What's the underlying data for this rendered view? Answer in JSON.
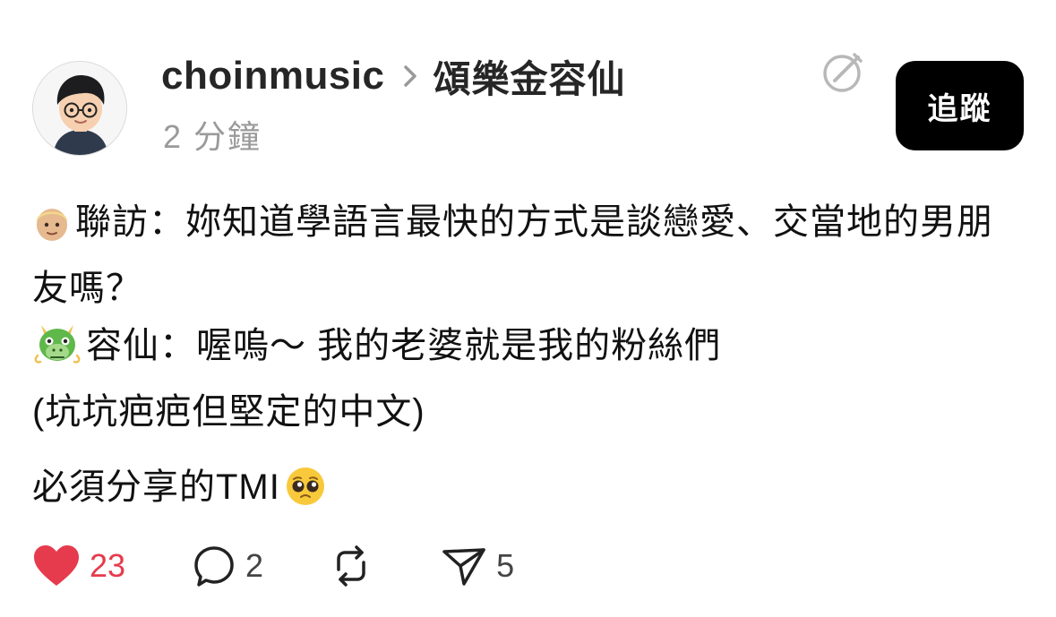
{
  "post": {
    "username": "choinmusic",
    "community": "頌樂金容仙",
    "timestamp": "2 分鐘",
    "follow_label": "追蹤",
    "lines": [
      "聯訪：妳知道學語言最快的方式是談戀愛、交當地的男朋友嗎？",
      "容仙：喔嗚～ 我的老婆就是我的粉絲們",
      "(坑坑疤疤但堅定的中文)",
      "必須分享的TMI"
    ],
    "emojis": [
      "person-face-emoji",
      "dragon-face-emoji",
      "pleading-face-emoji"
    ]
  },
  "actions": {
    "likes": "23",
    "comments": "2",
    "shares": "5"
  },
  "colors": {
    "like_red": "#e63b4d",
    "follow_bg": "#000000",
    "muted_text": "#9a9a9a"
  }
}
